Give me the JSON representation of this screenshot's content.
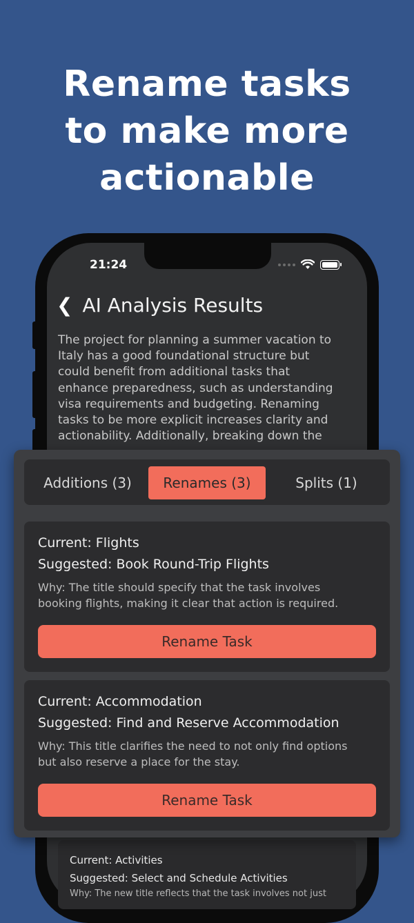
{
  "headline": {
    "line1": "Rename tasks",
    "line2": "to make more",
    "line3": "actionable"
  },
  "status_bar": {
    "time": "21:24",
    "icons": [
      "signal-dots-icon",
      "wifi-icon",
      "battery-icon"
    ]
  },
  "nav": {
    "back_icon": "chevron-left-icon",
    "title": "AI Analysis Results"
  },
  "summary": {
    "lines": [
      "The project for planning a summer vacation to",
      "Italy has a good foundational structure but",
      "could benefit from additional tasks that",
      "enhance preparedness, such as understanding",
      "visa requirements and budgeting. Renaming",
      "tasks to be more explicit increases clarity and",
      "actionability. Additionally, breaking down the"
    ]
  },
  "tabs": [
    {
      "label": "Additions (3)",
      "active": false
    },
    {
      "label": "Renames (3)",
      "active": true
    },
    {
      "label": "Splits (1)",
      "active": false
    }
  ],
  "renames": [
    {
      "current": "Current: Flights",
      "suggested": "Suggested: Book Round-Trip Flights",
      "why_lines": [
        "Why: The title should specify that the task involves",
        "booking flights, making it clear that action is required."
      ],
      "button": "Rename Task"
    },
    {
      "current": "Current: Accommodation",
      "suggested": "Suggested: Find and Reserve Accommodation",
      "why_lines": [
        "Why: This title clarifies the need to not only find options",
        "but also reserve a place for the stay."
      ],
      "button": "Rename Task"
    },
    {
      "current": "Current: Activities",
      "suggested": "Suggested: Select and Schedule Activities",
      "why_lines": [
        "Why: The new title reflects that the task involves not just"
      ]
    }
  ],
  "colors": {
    "background": "#34558b",
    "accent": "#f26d5b",
    "panel": "#3d3e41",
    "card": "#2c2c2e",
    "screen": "#2f3032"
  }
}
